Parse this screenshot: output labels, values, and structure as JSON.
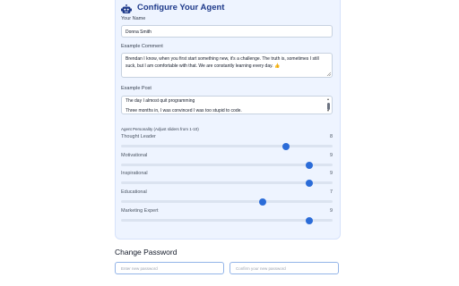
{
  "header": {
    "title": "Configure Your Agent",
    "icon": "robot-icon"
  },
  "name_field": {
    "label": "Your Name",
    "value": "Donna Smith"
  },
  "comment_field": {
    "label": "Example Comment",
    "value": "Brendan I know, when you first start something new, it's a challenge. The truth is, sometimes I still suck, but I am comfortable with that. We are constantly learning every day. 👍"
  },
  "post_field": {
    "label": "Example Post",
    "line1": "The day I almost quit programming",
    "line2": "Three months in, I was convinced I was too stupid to code."
  },
  "personality": {
    "label": "Agent Personality (Adjust sliders from 1-10)",
    "min": 1,
    "max": 10,
    "sliders": [
      {
        "name": "Thought Leader",
        "value": "8",
        "position": 0.78
      },
      {
        "name": "Motivational",
        "value": "9",
        "position": 0.89
      },
      {
        "name": "Inspirational",
        "value": "9",
        "position": 0.89
      },
      {
        "name": "Educational",
        "value": "7",
        "position": 0.67
      },
      {
        "name": "Marketing Expert",
        "value": "9",
        "position": 0.89
      }
    ]
  },
  "change_password": {
    "title": "Change Password",
    "new_placeholder": "Enter new password",
    "confirm_placeholder": "Confirm your new password"
  },
  "colors": {
    "accent": "#2b6cd8",
    "card_bg": "#eef4ff",
    "title": "#1e3a8a"
  }
}
